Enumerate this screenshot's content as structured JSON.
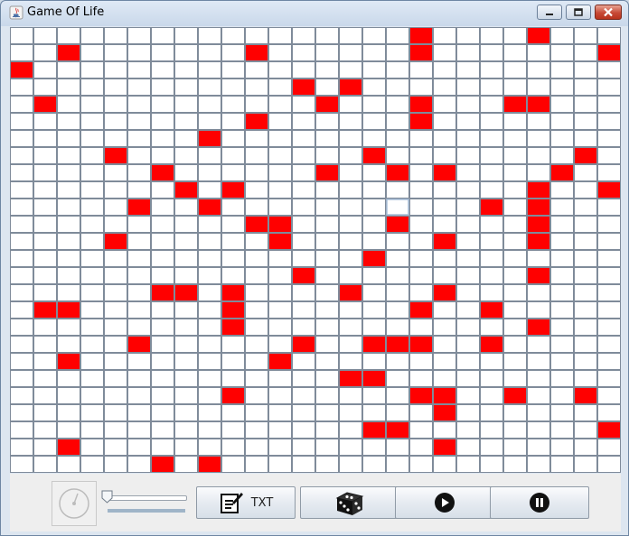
{
  "window": {
    "title": "Game Of Life",
    "controls": [
      "minimize",
      "maximize",
      "close"
    ]
  },
  "grid": {
    "rows": 26,
    "cols": 26,
    "alive_color": "#ff0000",
    "dead_color": "#ffffff",
    "highlight_color": "#a8bfd9",
    "alive_cells": [
      [
        0,
        17
      ],
      [
        0,
        22
      ],
      [
        1,
        2
      ],
      [
        1,
        10
      ],
      [
        1,
        17
      ],
      [
        1,
        25
      ],
      [
        2,
        0
      ],
      [
        3,
        12
      ],
      [
        3,
        14
      ],
      [
        4,
        1
      ],
      [
        4,
        13
      ],
      [
        4,
        17
      ],
      [
        4,
        21
      ],
      [
        4,
        22
      ],
      [
        5,
        10
      ],
      [
        5,
        17
      ],
      [
        6,
        8
      ],
      [
        7,
        4
      ],
      [
        7,
        15
      ],
      [
        7,
        24
      ],
      [
        8,
        6
      ],
      [
        8,
        13
      ],
      [
        8,
        16
      ],
      [
        8,
        18
      ],
      [
        8,
        23
      ],
      [
        9,
        7
      ],
      [
        9,
        9
      ],
      [
        9,
        22
      ],
      [
        9,
        25
      ],
      [
        10,
        5
      ],
      [
        10,
        8
      ],
      [
        10,
        20
      ],
      [
        10,
        22
      ],
      [
        11,
        10
      ],
      [
        11,
        11
      ],
      [
        11,
        16
      ],
      [
        11,
        22
      ],
      [
        12,
        4
      ],
      [
        12,
        11
      ],
      [
        12,
        18
      ],
      [
        12,
        22
      ],
      [
        13,
        15
      ],
      [
        14,
        12
      ],
      [
        14,
        22
      ],
      [
        15,
        6
      ],
      [
        15,
        7
      ],
      [
        15,
        9
      ],
      [
        15,
        14
      ],
      [
        15,
        18
      ],
      [
        16,
        1
      ],
      [
        16,
        2
      ],
      [
        16,
        9
      ],
      [
        16,
        17
      ],
      [
        16,
        20
      ],
      [
        17,
        9
      ],
      [
        17,
        22
      ],
      [
        18,
        5
      ],
      [
        18,
        12
      ],
      [
        18,
        15
      ],
      [
        18,
        16
      ],
      [
        18,
        17
      ],
      [
        18,
        20
      ],
      [
        19,
        2
      ],
      [
        19,
        11
      ],
      [
        20,
        14
      ],
      [
        20,
        15
      ],
      [
        21,
        9
      ],
      [
        21,
        17
      ],
      [
        21,
        18
      ],
      [
        21,
        21
      ],
      [
        21,
        24
      ],
      [
        22,
        18
      ],
      [
        23,
        15
      ],
      [
        23,
        16
      ],
      [
        23,
        25
      ],
      [
        24,
        2
      ],
      [
        24,
        18
      ],
      [
        25,
        6
      ],
      [
        25,
        8
      ]
    ],
    "highlight_cell": [
      10,
      16
    ]
  },
  "toolbar": {
    "speed_icon": "speedometer-icon",
    "slider_value": 0,
    "buttons": [
      {
        "name": "txt-button",
        "icon": "notepad-edit-icon",
        "label": "TXT"
      },
      {
        "name": "random-button",
        "icon": "dice-icon",
        "label": ""
      },
      {
        "name": "play-button",
        "icon": "play-icon",
        "label": ""
      },
      {
        "name": "pause-button",
        "icon": "pause-icon",
        "label": ""
      }
    ]
  }
}
